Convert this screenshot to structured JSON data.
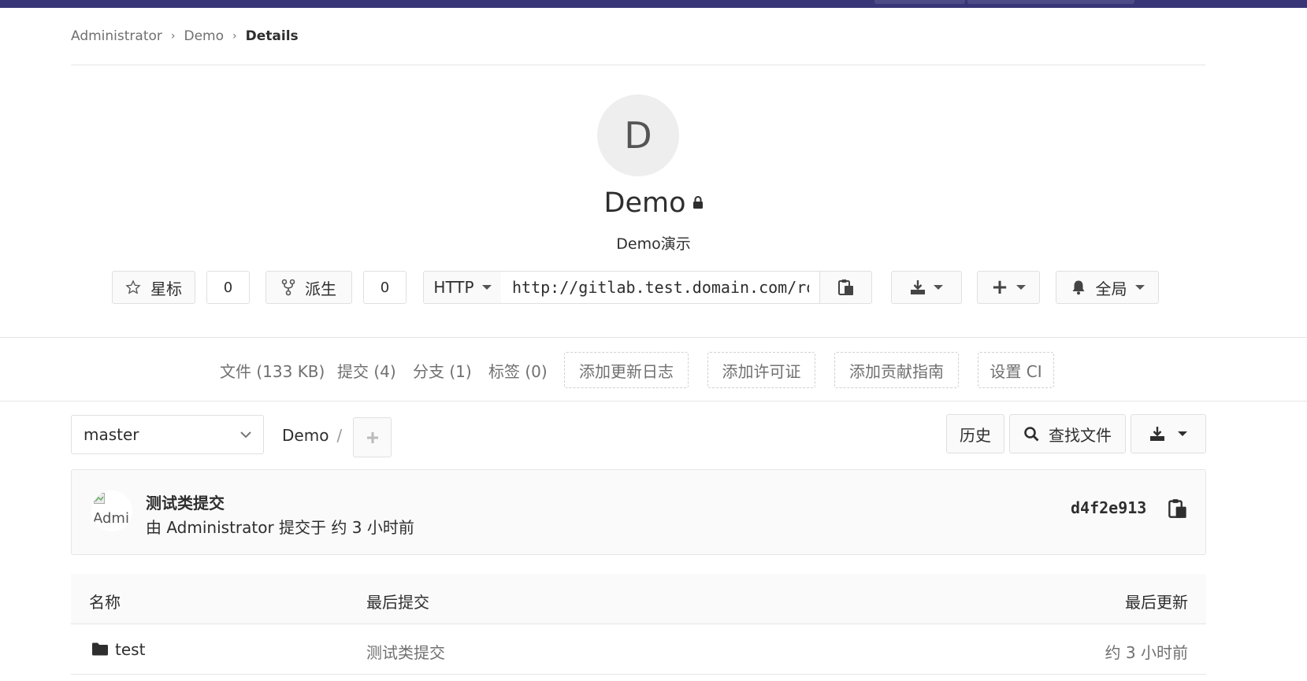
{
  "breadcrumb": [
    "Administrator",
    "Demo",
    "Details"
  ],
  "project": {
    "avatar_letter": "D",
    "name": "Demo",
    "description": "Demo演示"
  },
  "actions": {
    "star_label": "星标",
    "star_count": "0",
    "fork_label": "派生",
    "fork_count": "0",
    "protocol": "HTTP",
    "clone_url": "http://gitlab.test.domain.com/root/demo.git",
    "notification_label": "全局"
  },
  "stats": {
    "files": "文件 (133 KB)",
    "commits": "提交 (4)",
    "branches": "分支 (1)",
    "tags": "标签 (0)",
    "add_changelog": "添加更新日志",
    "add_license": "添加许可证",
    "add_contributing": "添加贡献指南",
    "setup_ci": "设置 CI"
  },
  "toolbar": {
    "branch": "master",
    "path_root": "Demo",
    "path_sep": "/",
    "history": "历史",
    "find_file": "查找文件"
  },
  "last_commit": {
    "avatar_alt": "Admi",
    "title": "测试类提交",
    "meta": "由 Administrator 提交于 约 3 小时前",
    "sha": "d4f2e913"
  },
  "tree": {
    "headers": [
      "名称",
      "最后提交",
      "最后更新"
    ],
    "rows": [
      {
        "name": "test",
        "commit": "测试类提交",
        "updated": "约 3 小时前"
      }
    ]
  },
  "colors": {
    "topbar": "#383677",
    "border": "#e0e0e0",
    "muted_text": "#707070"
  }
}
